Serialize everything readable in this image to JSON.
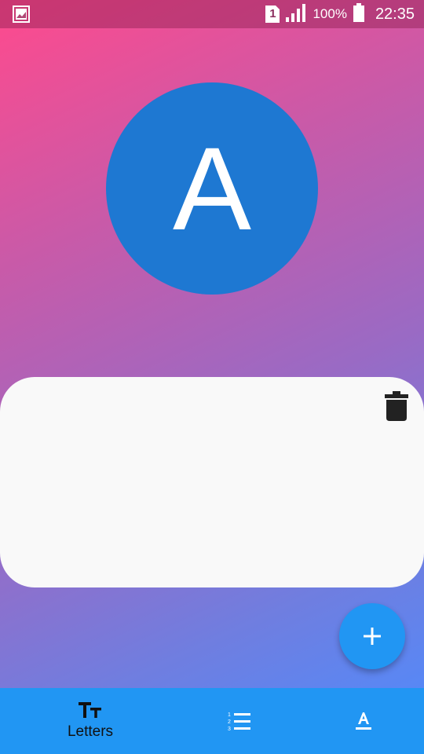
{
  "status_bar": {
    "sim_number": "1",
    "battery_percent": "100%",
    "time": "22:35",
    "icons": [
      "gallery-notification-icon",
      "sim-card-icon",
      "signal-icon",
      "battery-icon"
    ]
  },
  "avatar": {
    "letter": "A",
    "color": "#1e78d2"
  },
  "card": {
    "delete_icon": "trash-icon"
  },
  "fab": {
    "icon": "plus-icon",
    "color": "#2196f3"
  },
  "bottom_nav": {
    "items": [
      {
        "label": "Letters",
        "icon": "text-size-icon",
        "active": true
      },
      {
        "label": "",
        "icon": "numbered-list-icon",
        "active": false
      },
      {
        "label": "",
        "icon": "text-format-icon",
        "active": false
      }
    ],
    "color": "#2196f3"
  }
}
